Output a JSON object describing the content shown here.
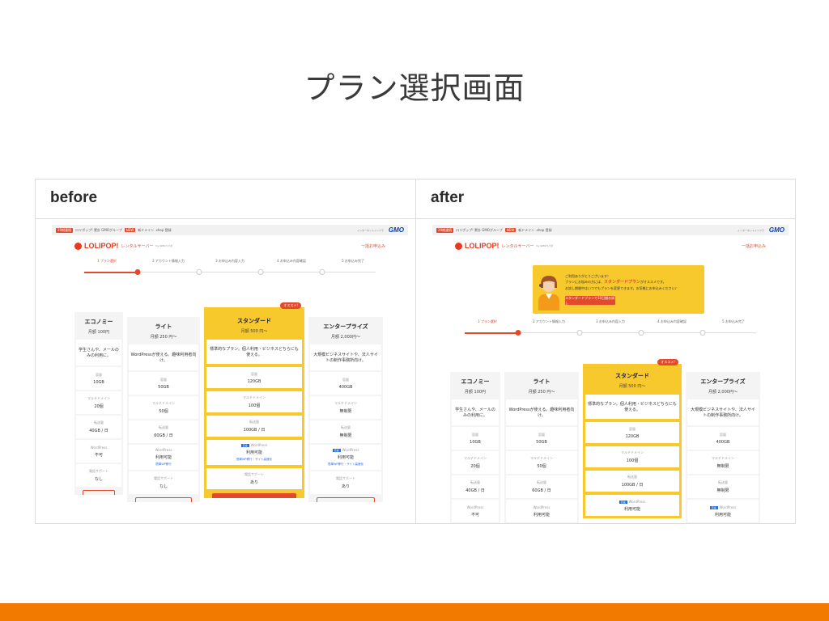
{
  "slide": {
    "title": "プラン選択画面"
  },
  "panels": [
    {
      "label": "before"
    },
    {
      "label": "after"
    }
  ],
  "site": {
    "tag1": "29期連続",
    "topbar_text1": "ロリポップ! 累計 GMOグループ",
    "tag2": "NEW",
    "topbar_text2": "新ドメイン .shop 登録",
    "gmo_sub": "インターネットインフラ",
    "gmo": "GMO",
    "logo_text": "LOLIPOP!",
    "logo_sub": "レンタルサーバー",
    "logo_sub2": "by GMOペパボ",
    "nav_link": "一括お申込み"
  },
  "steps": [
    "1 プラン選択",
    "2 アカウント情報入力",
    "3 お申込み内容入力",
    "4 お申込み内容確認",
    "5 お申込み完了"
  ],
  "promo": {
    "line1": "ご利用ありがとうございます！",
    "line2_prefix": "プランにお悩みの方には、",
    "line2_highlight": "スタンダードプラン",
    "line2_suffix": "がオススメです。",
    "line3": "お試し期間中はいつでもプランを変更できます。お気軽にお申込みください♪",
    "button": "スタンダードプランで10日間お試し"
  },
  "row_labels": {
    "storage": "容量",
    "domains": "マルチドメイン",
    "transfer": "転送量",
    "wordpress": "WordPress",
    "support": "電話サポート"
  },
  "plans": [
    {
      "name": "エコノミー",
      "price": "月額 100円",
      "desc": "学生さんや、メールのみの利用に。",
      "storage": "10GB",
      "domains": "20個",
      "transfer": "40GB / 日",
      "wordpress": "不可",
      "support": "なし"
    },
    {
      "name": "ライト",
      "price": "月額 250 円〜",
      "desc": "WordPressが使える。趣味利用者向け。",
      "storage": "50GB",
      "domains": "50個",
      "transfer": "60GB / 日",
      "wordpress": "利用可能",
      "wp_link": "簡単WP移行",
      "support": "なし"
    },
    {
      "name": "スタンダード",
      "price": "月額 500 円〜",
      "desc": "標準的なプラン。個人利用・ビジネスどちらにも使える。",
      "storage": "120GB",
      "domains": "100個",
      "transfer": "100GB / 日",
      "wordpress": "利用可能",
      "wp_link": "簡単WP移行・サイト高速化",
      "support": "あり",
      "ribbon": "オススメ!",
      "badge": "高速"
    },
    {
      "name": "エンタープライズ",
      "price": "月額 2,000円〜",
      "desc": "大規模ビジネスサイトや、法人サイトの制作事務所向け。",
      "storage": "400GB",
      "domains": "無制限",
      "transfer": "無制限",
      "wordpress": "利用可能",
      "wp_link": "簡単WP移行・サイト高速化",
      "support": "あり",
      "badge": "高速"
    }
  ]
}
